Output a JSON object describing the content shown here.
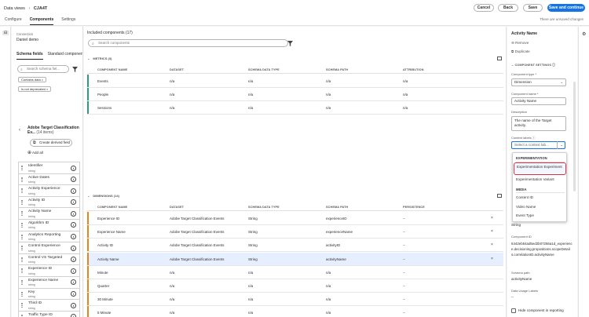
{
  "header": {
    "crumb_root": "Data views",
    "crumb_sep": "›",
    "crumb_current": "CJA4T",
    "tabs": [
      "Configure",
      "Components",
      "Settings"
    ],
    "buttons": {
      "cancel": "Cancel",
      "back": "Back",
      "save": "Save",
      "save_continue": "Save and continue"
    },
    "unsaved": "There are unsaved changes"
  },
  "left": {
    "connection_label": "Connection",
    "connection_value": "Daniel demo",
    "tabs": [
      "Schema fields",
      "Standard components"
    ],
    "search_placeholder": "Search schema fiel...",
    "filters": [
      "Contains data ×",
      "Is not deprecated ×"
    ],
    "group_title": "Adobe Target Classification Ev...",
    "group_count": "(14 items)",
    "create_derived": "Create derived field",
    "add_all": "Add all",
    "fields": [
      {
        "name": "Identifier",
        "type": "string"
      },
      {
        "name": "Active Dates",
        "type": "string"
      },
      {
        "name": "Activity Experience",
        "type": "string"
      },
      {
        "name": "Activity ID",
        "type": "string"
      },
      {
        "name": "Activity Name",
        "type": "string"
      },
      {
        "name": "Algorithm ID",
        "type": "string"
      },
      {
        "name": "Analytics Reporting",
        "type": "string"
      },
      {
        "name": "Control Experience",
        "type": "string"
      },
      {
        "name": "Control VS Targeted",
        "type": "string"
      },
      {
        "name": "Experience ID",
        "type": "string"
      },
      {
        "name": "Experience Name",
        "type": "string"
      },
      {
        "name": "Key",
        "type": "string"
      },
      {
        "name": "Third ID",
        "type": "string"
      },
      {
        "name": "Traffic Type ID",
        "type": "string"
      }
    ]
  },
  "center": {
    "title": "Included components (17)",
    "search_placeholder": "Search components",
    "metrics_header": "METRICS (3)",
    "metrics_columns": [
      "COMPONENT NAME",
      "DATASET",
      "SCHEMA DATA TYPE",
      "SCHEMA PATH",
      "ATTRIBUTION"
    ],
    "metrics": [
      {
        "name": "Events",
        "dataset": "n/a",
        "type": "n/a",
        "path": "n/a",
        "extra": "n/a"
      },
      {
        "name": "People",
        "dataset": "n/a",
        "type": "n/a",
        "path": "n/a",
        "extra": "n/a"
      },
      {
        "name": "Sessions",
        "dataset": "n/a",
        "type": "n/a",
        "path": "n/a",
        "extra": "n/a"
      }
    ],
    "dimensions_header": "DIMENSIONS (14)",
    "dimensions_columns": [
      "COMPONENT NAME",
      "DATASET",
      "SCHEMA DATA TYPE",
      "SCHEMA PATH",
      "PERSISTENCE"
    ],
    "dimensions": [
      {
        "name": "Experience ID",
        "dataset": "Adobe Target Classification Events",
        "type": "String",
        "path": "experienceID",
        "extra": "--",
        "remove": "×"
      },
      {
        "name": "Experience Name",
        "dataset": "Adobe Target Classification Events",
        "type": "String",
        "path": "experienceName",
        "extra": "--",
        "remove": "×"
      },
      {
        "name": "Activity ID",
        "dataset": "Adobe Target Classification Events",
        "type": "String",
        "path": "activityID",
        "extra": "--",
        "remove": "×"
      },
      {
        "name": "Activity Name",
        "dataset": "Adobe Target Classification Events",
        "type": "String",
        "path": "activityName",
        "extra": "--",
        "remove": "×"
      },
      {
        "name": "Minute",
        "dataset": "n/a",
        "type": "n/a",
        "path": "n/a",
        "extra": "--",
        "remove": ""
      },
      {
        "name": "Quarter",
        "dataset": "n/a",
        "type": "n/a",
        "path": "n/a",
        "extra": "--",
        "remove": ""
      },
      {
        "name": "30 Minute",
        "dataset": "n/a",
        "type": "n/a",
        "path": "n/a",
        "extra": "--",
        "remove": ""
      },
      {
        "name": "5 Minute",
        "dataset": "n/a",
        "type": "n/a",
        "path": "n/a",
        "extra": "--",
        "remove": ""
      }
    ],
    "accent_metrics": "#2d9d78",
    "accent_dimensions": "#e68619"
  },
  "right": {
    "title": "Activity Name",
    "remove": "Remove",
    "duplicate": "Duplicate",
    "section": "COMPONENT SETTINGS",
    "type_label": "Component type *",
    "type_value": "Dimension",
    "name_label": "Component name *",
    "name_value": "Activity Name",
    "desc_label": "Description",
    "desc_value": "The name of the Target activity.",
    "labels_label": "Content labels",
    "labels_placeholder": "Select a context lab...",
    "popover": {
      "group1": "EXPERIMENTATION",
      "item1": "Experimentation Experiment",
      "item2": "Experimentation Variant",
      "group2": "MEDIA",
      "item3": "Content ID",
      "item4": "Video Name",
      "item5": "Event Type"
    },
    "string_value": "String",
    "component_id_label": "Component ID",
    "component_id_value": "6442eb54ad5ed2b07256a1d_experience.decisioning.propositions.scopeDetails.correlationID.activityName",
    "schema_path_label": "Schema path",
    "schema_path_value": "activityName",
    "data_usage_label": "Data Usage Labels",
    "data_usage_value": "--",
    "hide_label": "Hide component in reporting"
  }
}
